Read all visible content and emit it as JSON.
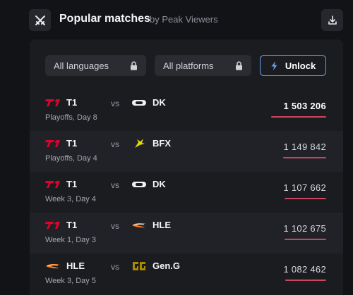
{
  "header": {
    "title": "Popular matches",
    "subtitle": "by Peak Viewers"
  },
  "filters": {
    "languages": "All languages",
    "platforms": "All platforms",
    "unlock": "Unlock"
  },
  "matches": [
    {
      "team1": "T1",
      "team2": "DK",
      "vs": "vs",
      "stage": "Playoffs, Day 8",
      "viewers": "1 503 206",
      "viewers_value": 1503206
    },
    {
      "team1": "T1",
      "team2": "BFX",
      "vs": "vs",
      "stage": "Playoffs, Day 4",
      "viewers": "1 149 842",
      "viewers_value": 1149842
    },
    {
      "team1": "T1",
      "team2": "DK",
      "vs": "vs",
      "stage": "Week 3, Day 4",
      "viewers": "1 107 662",
      "viewers_value": 1107662
    },
    {
      "team1": "T1",
      "team2": "HLE",
      "vs": "vs",
      "stage": "Week 1, Day 3",
      "viewers": "1 102 675",
      "viewers_value": 1102675
    },
    {
      "team1": "HLE",
      "team2": "Gen.G",
      "vs": "vs",
      "stage": "Week 3, Day 5",
      "viewers": "1 082 462",
      "viewers_value": 1082462
    }
  ],
  "colors": {
    "accent_bar": "#c9475e",
    "t1_red": "#e2012d",
    "unlock_border": "#6a9ee8",
    "gen_gold": "#aa8a00",
    "bfx_yellow": "#e6d800"
  }
}
